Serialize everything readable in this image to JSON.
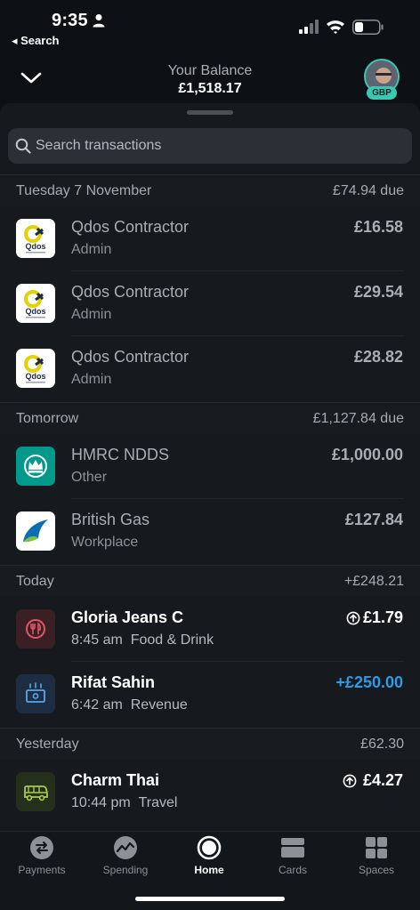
{
  "status_bar": {
    "time": "9:35",
    "back_label": "◂ Search"
  },
  "header": {
    "balance_label": "Your Balance",
    "balance_value": "£1,518.17",
    "currency_badge": "GBP"
  },
  "search": {
    "placeholder": "Search transactions"
  },
  "sections": [
    {
      "date": "Tuesday 7 November",
      "summary": "£74.94 due",
      "rows": [
        {
          "name": "Qdos Contractor",
          "sub": "Admin",
          "amount": "£16.58",
          "icon": "qdos-logo"
        },
        {
          "name": "Qdos Contractor",
          "sub": "Admin",
          "amount": "£29.54",
          "icon": "qdos-logo"
        },
        {
          "name": "Qdos Contractor",
          "sub": "Admin",
          "amount": "£28.82",
          "icon": "qdos-logo"
        }
      ]
    },
    {
      "date": "Tomorrow",
      "summary": "£1,127.84 due",
      "rows": [
        {
          "name": "HMRC NDDS",
          "sub": "Other",
          "amount": "£1,000.00",
          "icon": "hmrc-crown-logo"
        },
        {
          "name": "British Gas",
          "sub": "Workplace",
          "amount": "£127.84",
          "icon": "british-gas-logo"
        }
      ]
    },
    {
      "date": "Today",
      "summary": "+£248.21",
      "rows": [
        {
          "name": "Gloria Jeans C",
          "time": "8:45 am",
          "category": "Food & Drink",
          "amount": "£1.79",
          "icon": "food-drink-icon",
          "roundup": true
        },
        {
          "name": "Rifat Sahin",
          "time": "6:42 am",
          "category": "Revenue",
          "amount": "+£250.00",
          "icon": "revenue-icon",
          "positive": true
        }
      ]
    },
    {
      "date": "Yesterday",
      "summary": "£62.30",
      "rows": [
        {
          "name": "Charm Thai",
          "time": "10:44 pm",
          "category": "Travel",
          "amount": "£4.27",
          "icon": "travel-bus-icon",
          "roundup": true
        }
      ]
    }
  ],
  "tabs": [
    {
      "label": "Payments",
      "icon": "payments-icon"
    },
    {
      "label": "Spending",
      "icon": "spending-icon"
    },
    {
      "label": "Home",
      "icon": "home-icon",
      "active": true
    },
    {
      "label": "Cards",
      "icon": "cards-icon"
    },
    {
      "label": "Spaces",
      "icon": "spaces-icon"
    }
  ],
  "colors": {
    "accent_teal": "#3cc8b0",
    "positive_blue": "#2e9be6",
    "background": "#0d1116"
  }
}
